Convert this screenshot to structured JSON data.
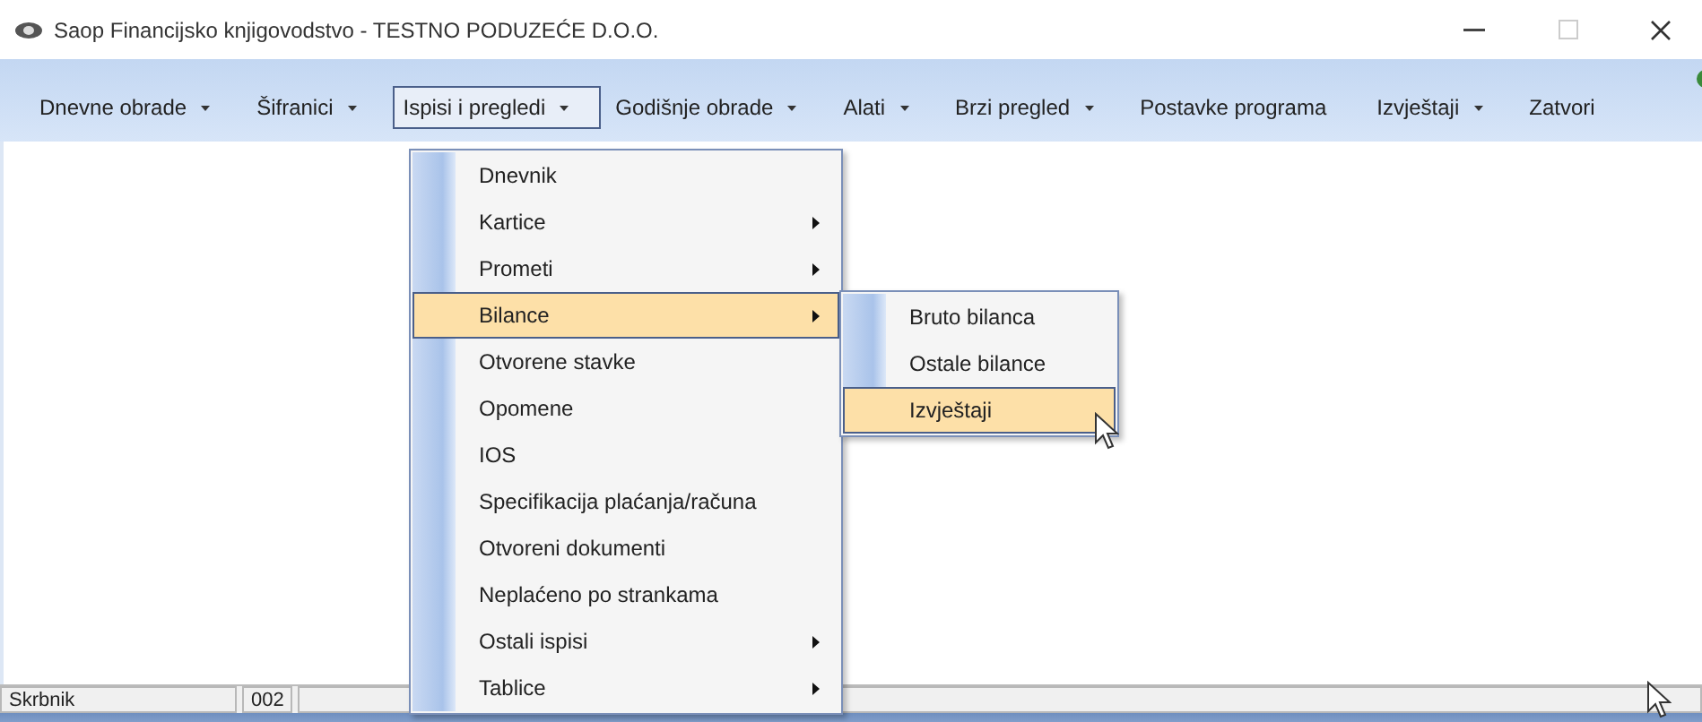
{
  "window": {
    "title": "Saop Financijsko knjigovodstvo - TESTNO PODUZEĆE D.O.O."
  },
  "menu_bar": [
    {
      "label": "Dnevne obrade",
      "has_dropdown": true,
      "selected": false
    },
    {
      "label": "Šifranici",
      "has_dropdown": true,
      "selected": false
    },
    {
      "label": "Ispisi i pregledi",
      "has_dropdown": true,
      "selected": true
    },
    {
      "label": "Godišnje obrade",
      "has_dropdown": true,
      "selected": false
    },
    {
      "label": "Alati",
      "has_dropdown": true,
      "selected": false
    },
    {
      "label": "Brzi pregled",
      "has_dropdown": true,
      "selected": false
    },
    {
      "label": "Postavke programa",
      "has_dropdown": false,
      "selected": false
    },
    {
      "label": "Izvještaji",
      "has_dropdown": true,
      "selected": false
    },
    {
      "label": "Zatvori",
      "has_dropdown": false,
      "selected": false
    }
  ],
  "open_menu": {
    "items": [
      {
        "label": "Dnevnik",
        "has_submenu": false,
        "selected": false
      },
      {
        "label": "Kartice",
        "has_submenu": true,
        "selected": false
      },
      {
        "label": "Prometi",
        "has_submenu": true,
        "selected": false
      },
      {
        "label": "Bilance",
        "has_submenu": true,
        "selected": true
      },
      {
        "label": "Otvorene stavke",
        "has_submenu": false,
        "selected": false
      },
      {
        "label": "Opomene",
        "has_submenu": false,
        "selected": false
      },
      {
        "label": "IOS",
        "has_submenu": false,
        "selected": false
      },
      {
        "label": "Specifikacija plaćanja/računa",
        "has_submenu": false,
        "selected": false
      },
      {
        "label": "Otvoreni dokumenti",
        "has_submenu": false,
        "selected": false
      },
      {
        "label": "Neplaćeno po strankama",
        "has_submenu": false,
        "selected": false
      },
      {
        "label": "Ostali ispisi",
        "has_submenu": true,
        "selected": false
      },
      {
        "label": "Tablice",
        "has_submenu": true,
        "selected": false
      }
    ]
  },
  "submenu": {
    "items": [
      {
        "label": "Bruto bilanca",
        "selected": false
      },
      {
        "label": "Ostale bilance",
        "selected": false
      },
      {
        "label": "Izvještaji",
        "selected": true
      }
    ]
  },
  "status_bar": {
    "panels": [
      {
        "text": "Skrbnik"
      },
      {
        "text": "002"
      }
    ]
  }
}
